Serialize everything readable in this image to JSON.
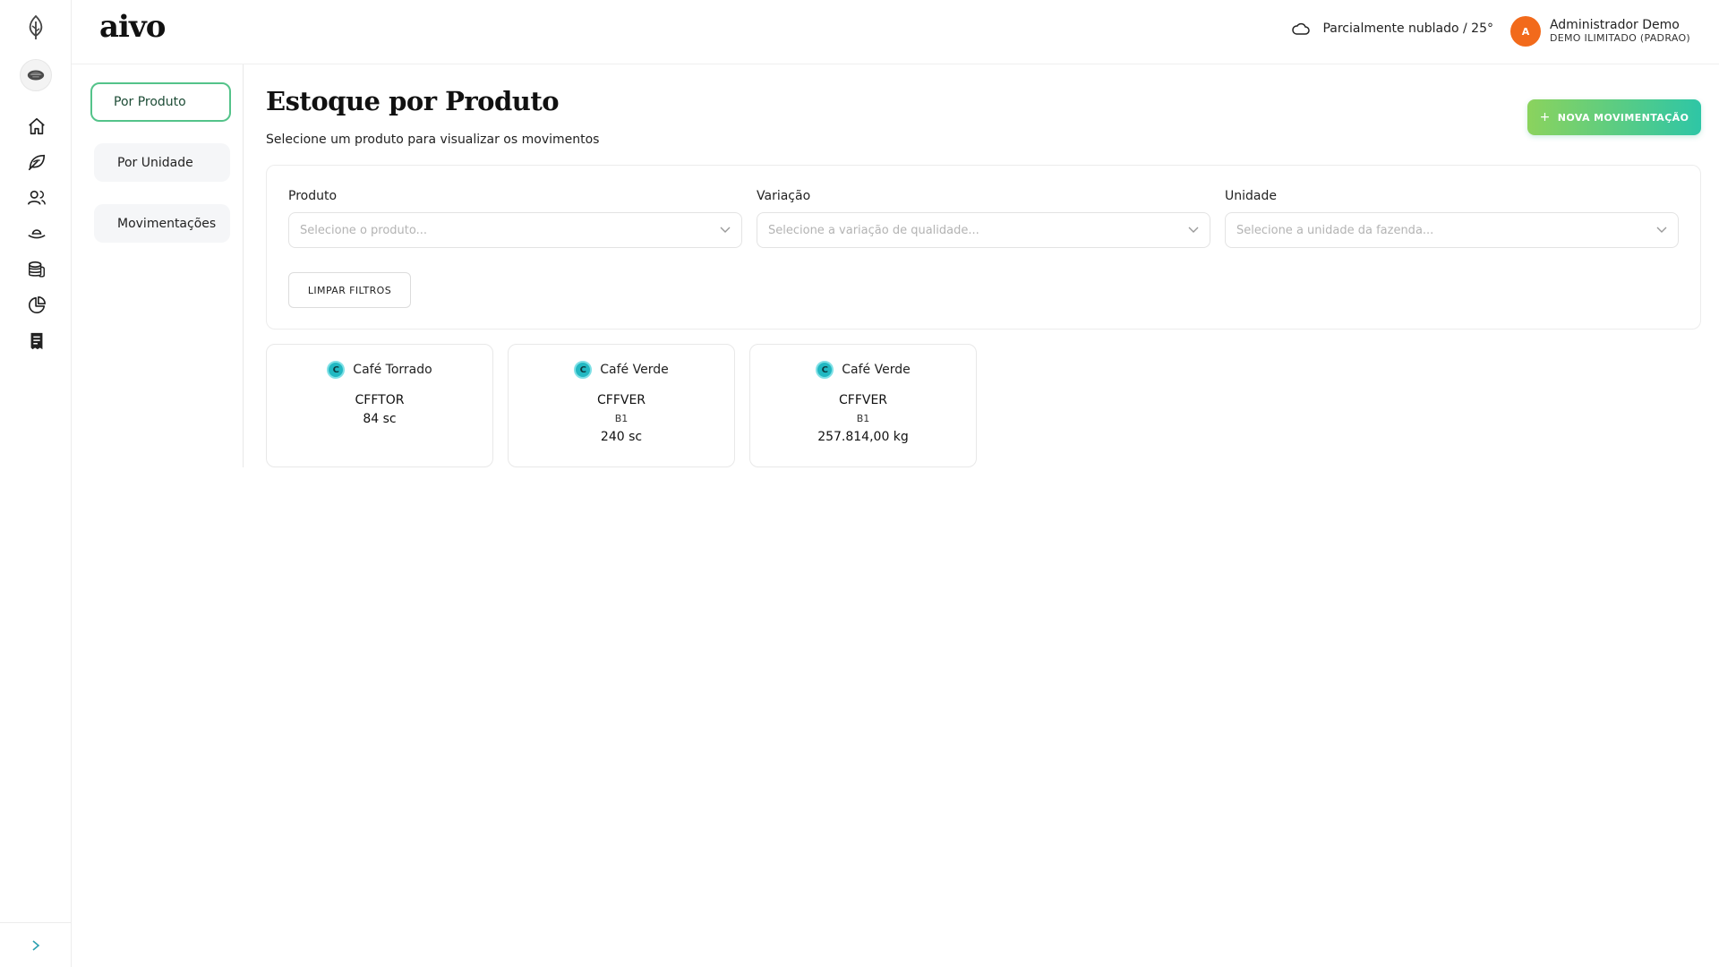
{
  "brand": {
    "name": "aivo"
  },
  "header": {
    "weather": "Parcialmente nublado / 25°",
    "user": {
      "initial": "A",
      "name": "Administrador Demo",
      "plan": "DEMO ILIMITADO (PADRAO)"
    }
  },
  "rail": {
    "icons": [
      "leaf-drop-icon",
      "home-icon",
      "leaf-icon",
      "users-icon",
      "hat-icon",
      "coins-icon",
      "pie-chart-icon",
      "receipt-icon"
    ]
  },
  "subnav": {
    "items": [
      {
        "label": "Por Produto",
        "active": true
      },
      {
        "label": "Por Unidade",
        "active": false
      },
      {
        "label": "Movimentações",
        "active": false
      }
    ]
  },
  "page": {
    "title": "Estoque por Produto",
    "subtitle": "Selecione um produto para visualizar os movimentos",
    "new_button": "NOVA MOVIMENTAÇÃO"
  },
  "filters": {
    "product": {
      "label": "Produto",
      "placeholder": "Selecione o produto..."
    },
    "variation": {
      "label": "Variação",
      "placeholder": "Selecione a variação de qualidade..."
    },
    "unit": {
      "label": "Unidade",
      "placeholder": "Selecione a unidade da fazenda..."
    },
    "clear_button": "LIMPAR FILTROS"
  },
  "products": [
    {
      "badge": "C",
      "name": "Café Torrado",
      "code": "CFFTOR",
      "variation": "",
      "quantity": "84 sc"
    },
    {
      "badge": "C",
      "name": "Café Verde",
      "code": "CFFVER",
      "variation": "B1",
      "quantity": "240 sc"
    },
    {
      "badge": "C",
      "name": "Café Verde",
      "code": "CFFVER",
      "variation": "B1",
      "quantity": "257.814,00 kg"
    }
  ],
  "colors": {
    "accent": "#54c38a",
    "gradient_start": "#8bd35d",
    "gradient_end": "#2ec6a6",
    "avatar": "#f26a1b",
    "badge": "#22b8c2"
  }
}
